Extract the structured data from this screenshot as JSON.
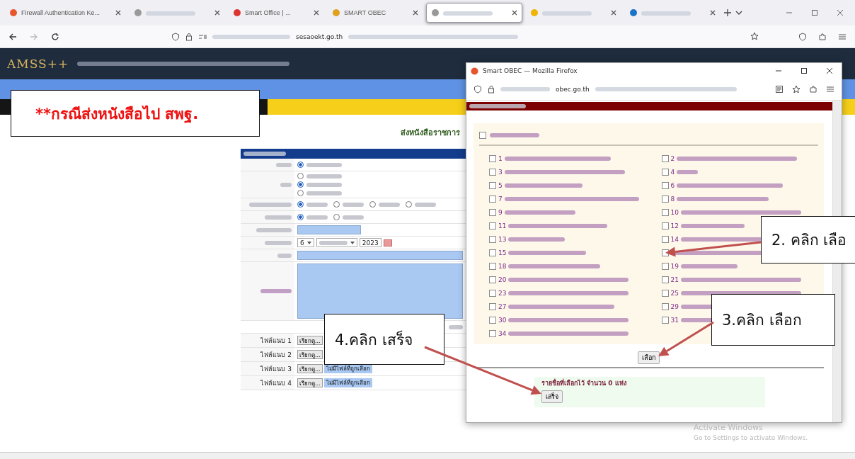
{
  "browser": {
    "tabs": [
      {
        "label": "Firewall Authentication Ke...",
        "selected": false
      },
      {
        "selected": false
      },
      {
        "label": "Smart Office | ...",
        "selected": false
      },
      {
        "label": "SMART OBEC",
        "selected": false
      },
      {
        "selected": true
      },
      {
        "selected": false
      },
      {
        "selected": false
      }
    ],
    "url_domain": "sesaoekt.go.th"
  },
  "header": {
    "logo": "AMSS++"
  },
  "form": {
    "title": "ส่งหนังสือราชการ",
    "radio_groups": [
      {
        "options": [
          {
            "selected": true
          }
        ]
      },
      {
        "options": [
          {
            "selected": false
          },
          {
            "selected": true
          },
          {
            "selected": false
          }
        ]
      },
      {
        "options": [
          {
            "selected": true
          },
          {
            "selected": false
          },
          {
            "selected": false
          },
          {
            "selected": false
          }
        ]
      },
      {
        "options": [
          {
            "selected": true
          },
          {
            "selected": false
          }
        ]
      }
    ],
    "date": {
      "day": "6",
      "year": "2023"
    },
    "attachments": [
      {
        "label": "ไฟล์แนบ 1",
        "button": "เรียกดู..."
      },
      {
        "label": "ไฟล์แนบ 2",
        "button": "เรียกดู..."
      },
      {
        "label": "ไฟล์แนบ 3",
        "button": "เรียกดู...",
        "status": "ไม่มีไฟล์ที่ถูกเลือก"
      },
      {
        "label": "ไฟล์แนบ 4",
        "button": "เรียกดู...",
        "status": "ไม่มีไฟล์ที่ถูกเลือก"
      }
    ]
  },
  "popup": {
    "title": "Smart OBEC — Mozilla Firefox",
    "url_domain": "obec.go.th",
    "select_all": {
      "checked": false
    },
    "left_items": [
      {
        "number": "1",
        "checked": false
      },
      {
        "number": "3",
        "checked": false
      },
      {
        "number": "5",
        "checked": false
      },
      {
        "number": "7",
        "checked": false
      },
      {
        "number": "9",
        "checked": false
      },
      {
        "number": "11",
        "checked": false
      },
      {
        "number": "13",
        "checked": false
      },
      {
        "number": "15",
        "checked": false
      },
      {
        "number": "18",
        "checked": false
      },
      {
        "number": "20",
        "checked": false
      },
      {
        "number": "23",
        "checked": false
      },
      {
        "number": "27",
        "checked": false
      },
      {
        "number": "30",
        "checked": false
      },
      {
        "number": "34",
        "checked": false
      }
    ],
    "right_items": [
      {
        "number": "2",
        "checked": false
      },
      {
        "number": "4",
        "checked": false
      },
      {
        "number": "6",
        "checked": false
      },
      {
        "number": "8",
        "checked": false
      },
      {
        "number": "10",
        "checked": false
      },
      {
        "number": "12",
        "checked": false
      },
      {
        "number": "14",
        "checked": false
      },
      {
        "checked": false
      },
      {
        "number": "19",
        "checked": false
      },
      {
        "number": "21",
        "checked": false
      },
      {
        "number": "25",
        "checked": false
      },
      {
        "number": "29",
        "checked": false
      },
      {
        "number": "31",
        "checked": false
      }
    ],
    "select_button": "เลือก",
    "summary": "รายชื่อที่เลือกไว้ จำนวน 0 แห่ง",
    "done_button": "เสร็จ"
  },
  "annotations": [
    {
      "kind": "note",
      "text": "**กรณีส่งหนังสือไป สพฐ."
    },
    {
      "kind": "step",
      "text": "2. คลิก เลือ"
    },
    {
      "kind": "step",
      "text": "3.คลิก เลือก"
    },
    {
      "kind": "step",
      "text": "4.คลิก เสร็จ"
    }
  ],
  "os_notice": {
    "title": "Activate Windows",
    "hint": "Go to Settings to activate Windows."
  }
}
